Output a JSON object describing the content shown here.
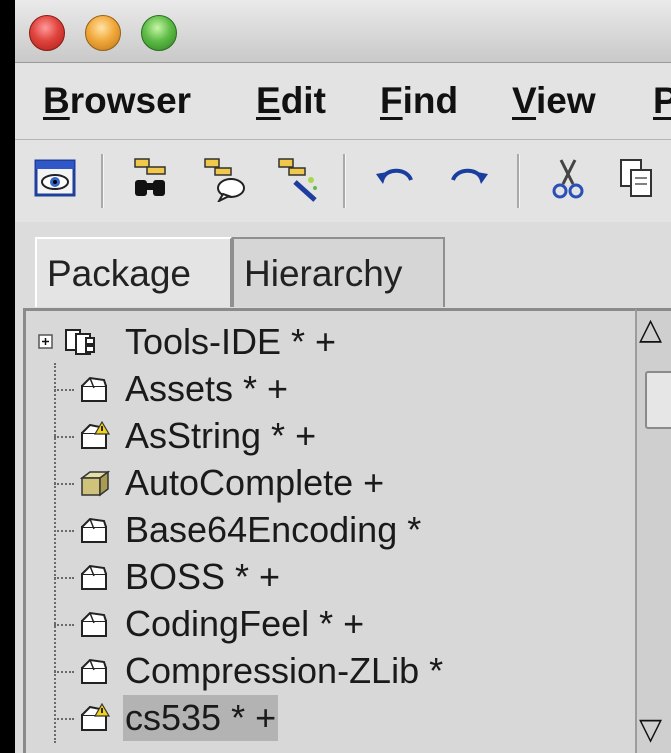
{
  "menu": {
    "items": [
      {
        "underline": "B",
        "rest": "rowser"
      },
      {
        "underline": "E",
        "rest": "dit"
      },
      {
        "underline": "F",
        "rest": "ind"
      },
      {
        "underline": "V",
        "rest": "iew"
      },
      {
        "underline": "P",
        "rest": ""
      }
    ]
  },
  "toolbar": {
    "icons": [
      "browse-eye-icon",
      "find-binoculars-icon",
      "find-comment-icon",
      "magic-wand-icon",
      "undo-icon",
      "redo-icon",
      "cut-icon",
      "copy-icon"
    ]
  },
  "tabs": [
    {
      "label": "Package",
      "active": true
    },
    {
      "label": "Hierarchy",
      "active": false
    }
  ],
  "tree": {
    "items": [
      {
        "label": "Tools-IDE * +",
        "icon": "component-package-icon",
        "expander": "+"
      },
      {
        "label": "Assets * +",
        "icon": "open-package-icon"
      },
      {
        "label": "AsString * +",
        "icon": "package-warning-icon"
      },
      {
        "label": "AutoComplete +",
        "icon": "closed-package-icon"
      },
      {
        "label": "Base64Encoding *",
        "icon": "open-package-icon"
      },
      {
        "label": "BOSS * +",
        "icon": "open-package-icon"
      },
      {
        "label": "CodingFeel * +",
        "icon": "open-package-icon"
      },
      {
        "label": "Compression-ZLib *",
        "icon": "open-package-icon"
      },
      {
        "label": "cs535 * +",
        "icon": "package-warning-icon",
        "selected": true
      }
    ]
  },
  "colors": {
    "background": "#dcdcdc",
    "selection": "#b3b3b3",
    "close": "#e0443e",
    "minimize": "#f2a93b",
    "zoom": "#5fbd47"
  }
}
